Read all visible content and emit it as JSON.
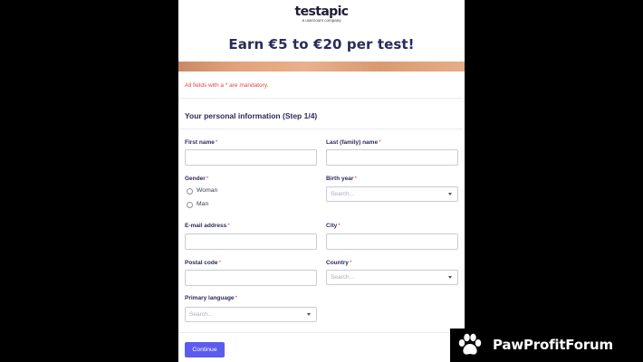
{
  "brand": {
    "logo_text": "testapic",
    "tagline": "a userzoom company"
  },
  "headline": "Earn €5 to €20 per test!",
  "notice": "All fields with a * are mandatory.",
  "section_title": "Your personal information (Step 1/4)",
  "required_marker": "*",
  "fields": {
    "first_name": {
      "label": "First name",
      "value": ""
    },
    "last_name": {
      "label": "Last (family) name",
      "value": ""
    },
    "gender": {
      "label": "Gender",
      "options": [
        "Woman",
        "Man"
      ],
      "selected": null
    },
    "birth_year": {
      "label": "Birth year",
      "placeholder": "Search..."
    },
    "email": {
      "label": "E-mail address",
      "value": ""
    },
    "city": {
      "label": "City",
      "value": ""
    },
    "postal_code": {
      "label": "Postal code",
      "value": ""
    },
    "country": {
      "label": "Country",
      "placeholder": "Search..."
    },
    "primary_language": {
      "label": "Primary language",
      "placeholder": "Search..."
    }
  },
  "continue_label": "Continue",
  "watermark": {
    "text": "PawProfitForum",
    "icon": "paw-icon"
  },
  "colors": {
    "primary": "#5b5bf0",
    "heading": "#2c2a5a",
    "required": "#e0463c",
    "background": "#000000"
  }
}
